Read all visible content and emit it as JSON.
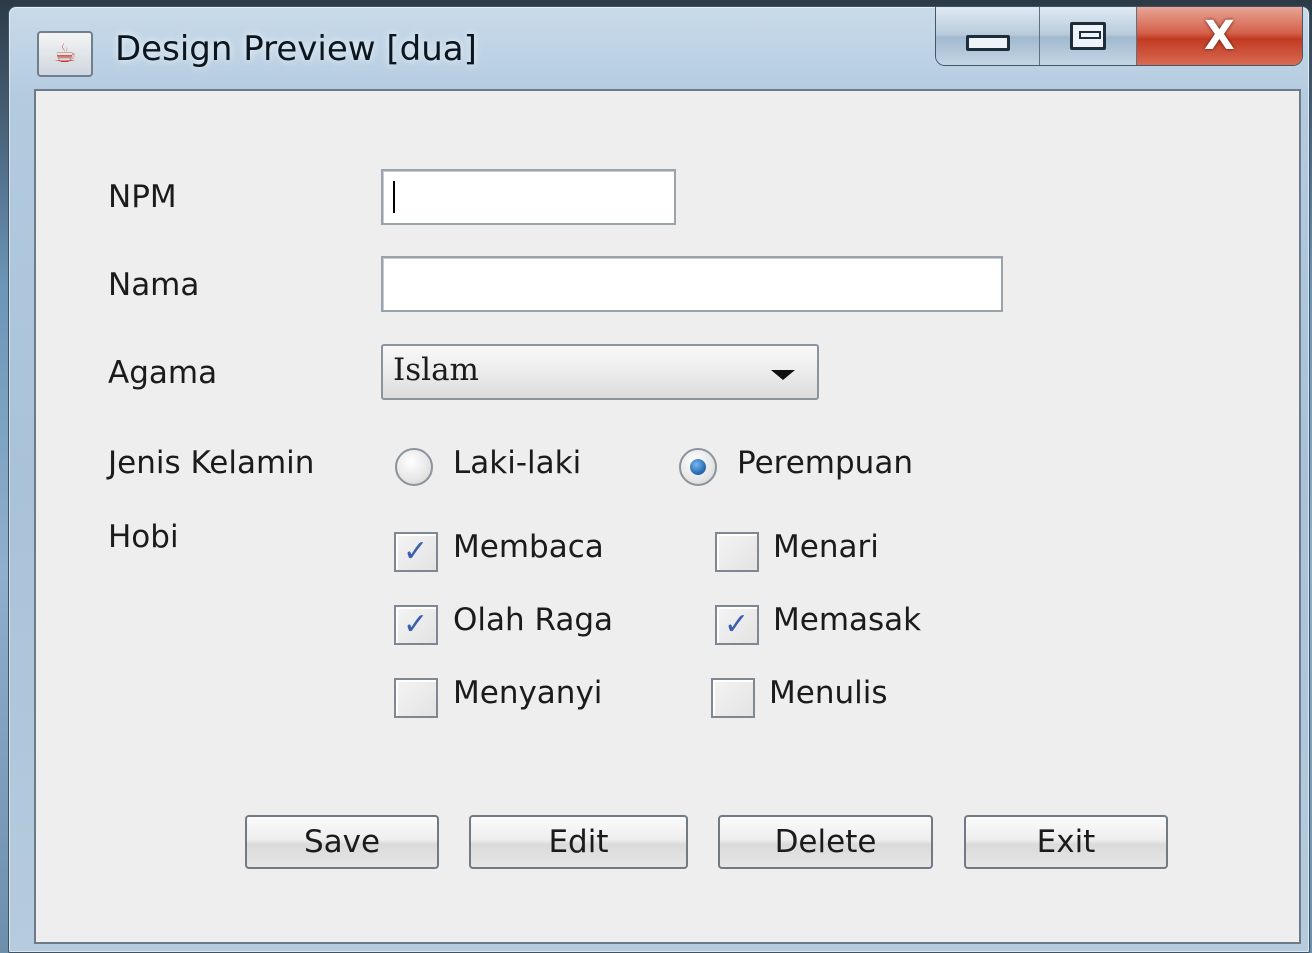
{
  "window": {
    "title": "Design Preview [dua]",
    "app_icon": "java-coffee-icon",
    "caption_buttons": {
      "minimize": "minimize-icon",
      "maximize": "maximize-icon",
      "close": "X"
    }
  },
  "form": {
    "npm": {
      "label": "NPM",
      "value": ""
    },
    "nama": {
      "label": "Nama",
      "value": ""
    },
    "agama": {
      "label": "Agama",
      "selected": "Islam"
    },
    "jenis_kelamin": {
      "label": "Jenis Kelamin",
      "options": [
        {
          "label": "Laki-laki",
          "selected": false
        },
        {
          "label": "Perempuan",
          "selected": true
        }
      ]
    },
    "hobi": {
      "label": "Hobi",
      "options": [
        {
          "label": "Membaca",
          "checked": true
        },
        {
          "label": "Menari",
          "checked": false
        },
        {
          "label": "Olah Raga",
          "checked": true
        },
        {
          "label": "Memasak",
          "checked": true
        },
        {
          "label": "Menyanyi",
          "checked": false
        },
        {
          "label": "Menulis",
          "checked": false
        }
      ],
      "check_mark": "✓"
    }
  },
  "buttons": {
    "save": "Save",
    "edit": "Edit",
    "delete": "Delete",
    "exit": "Exit"
  },
  "colors": {
    "client_bg": "#eeeeee",
    "check_mark": "#3b5fb0",
    "close_button": "#c23a22"
  }
}
